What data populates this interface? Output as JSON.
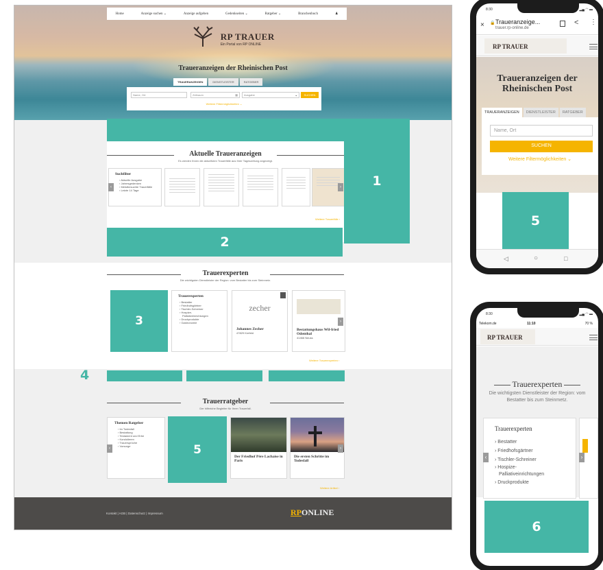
{
  "colors": {
    "teal": "#45b6a6",
    "accent": "#f5b400",
    "footer": "#4d4b49"
  },
  "desktop": {
    "nav": [
      "Home",
      "Anzeige suchen ⌄",
      "Anzeige aufgeben",
      "Gedenkseiten ⌄",
      "Ratgeber ⌄",
      "Branchenbuch",
      "♟"
    ],
    "logo_main": "RP TRAUER",
    "logo_sub": "Ein Portal von RP ONLINE",
    "hero_title": "Traueranzeigen der Rheinischen Post",
    "tabs": [
      "TRAUERANZEIGEN",
      "DIENSTLEISTER",
      "RATGEBER"
    ],
    "search": {
      "name_placeholder": "Name, Ort",
      "date_placeholder": "Zeitraum",
      "edition_placeholder": "Ausgabe",
      "button": "SUCHEN",
      "more": "Weitere Filtermöglichkeiten ⌄"
    },
    "notices": {
      "title": "Aktuelle Traueranzeigen",
      "subtitle": "Es werden Ihnen die aktuellsten Trauerfälle aus Ihrer Tageszeitung angezeigt.",
      "filter_title": "Suchfilter",
      "filters": [
        "› Aktuelle Ausgabe",
        "› Jahresgedenken",
        "› Meistbesuchte Trauerfälle",
        "› Letzte 14 Tage"
      ],
      "more": "Weitere Trauerfälle ›"
    },
    "experts": {
      "title": "Trauerexperten",
      "subtitle": "Die wichtigsten Dienstleister der Region: vom Bestatter bis zum Steinmetz.",
      "list_title": "Trauerexperten",
      "list": [
        "› Bestatter",
        "› Friedhofsgärtner",
        "› Tischler-Schreiner",
        "› Hospize-",
        "Palliativeinrichtungen",
        "› Druckprodukte",
        "› Gastronomie"
      ],
      "card1_logo": "zecher",
      "card1_name": "Johannes Zecher",
      "card1_city": "47829 Krefeld",
      "card2_name": "Bestattungshaus Wil-fried Odenthal",
      "card2_city": "41466 Neuss",
      "more": "Weitere Trauerexperten ›"
    },
    "advice": {
      "title": "Trauerratgeber",
      "subtitle": "Der hilfreiche Begleiter für Ihren Trauerfall.",
      "list_title": "Themen Ratgeber",
      "list": [
        "› Im Todesfall",
        "› Bestattung",
        "› Testament und Erbe",
        "› Kondolieren",
        "› Trauersprüche",
        "› Vorsorge"
      ],
      "card1": "Der Friedhof Père Lachaise in Paris",
      "card2": "Die ersten Schritte im Todesfall",
      "more": "Weitere Artikel ›"
    },
    "footer": {
      "links": "Kontakt   |   AGB   |   Datenschutz   |   Impressum",
      "logo_rp": "RP",
      "logo_online": "ONLINE"
    }
  },
  "labels": {
    "one": "1",
    "two": "2",
    "three": "3",
    "four": "4",
    "five": "5",
    "six": "6"
  },
  "phone1": {
    "time": "8:30",
    "tab_title": "Traueranzeige...",
    "url": "trauer.rp-online.de",
    "logo": "RP TRAUER",
    "title": "Traueranzeigen der Rheinischen Post",
    "tabs": [
      "TRAUERANZEIGEN",
      "DIENSTLEISTER",
      "RATGEBER"
    ],
    "search_placeholder": "Name, Ort",
    "button": "SUCHEN",
    "more": "Weitere Filtermöglichkeiten ⌄"
  },
  "phone2": {
    "time": "8:30",
    "carrier": "Telekom.de",
    "clock": "11:10",
    "battery": "70 %",
    "logo": "RP TRAUER",
    "title": "Trauerexperten",
    "subtitle": "Die wichtigsten Dienstleister der Region: vom Bestatter bis zum Steinmetz.",
    "list_title": "Trauerexperten",
    "list": [
      "› Bestatter",
      "› Friedhofsgärtner",
      "› Tischler-Schreiner",
      "› Hospize-",
      "Palliativeinrichtungen",
      "› Druckprodukte"
    ]
  }
}
